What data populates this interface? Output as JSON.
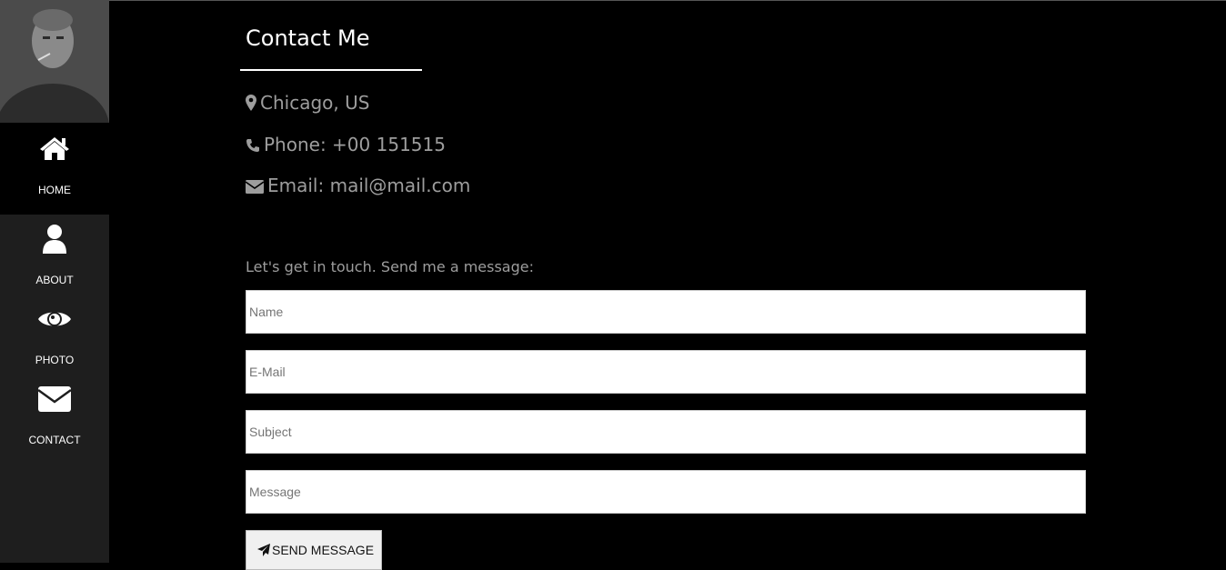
{
  "nav": {
    "items": [
      {
        "label": "HOME",
        "icon": "home-icon",
        "active": true
      },
      {
        "label": "ABOUT",
        "icon": "user-icon",
        "active": false
      },
      {
        "label": "PHOTO",
        "icon": "eye-icon",
        "active": false
      },
      {
        "label": "CONTACT",
        "icon": "envelope-icon",
        "active": false
      }
    ]
  },
  "contact": {
    "title": "Contact Me",
    "location": "Chicago, US",
    "phone": "Phone: +00 151515",
    "email": "Email: mail@mail.com",
    "intro": "Let's get in touch. Send me a message:"
  },
  "form": {
    "name_placeholder": "Name",
    "email_placeholder": "E-Mail",
    "subject_placeholder": "Subject",
    "message_placeholder": "Message",
    "send_label": "SEND MESSAGE"
  },
  "colors": {
    "background": "#000000",
    "sidebar": "#1e1e1e",
    "muted_text": "#9d9d9d",
    "text": "#ffffff"
  }
}
